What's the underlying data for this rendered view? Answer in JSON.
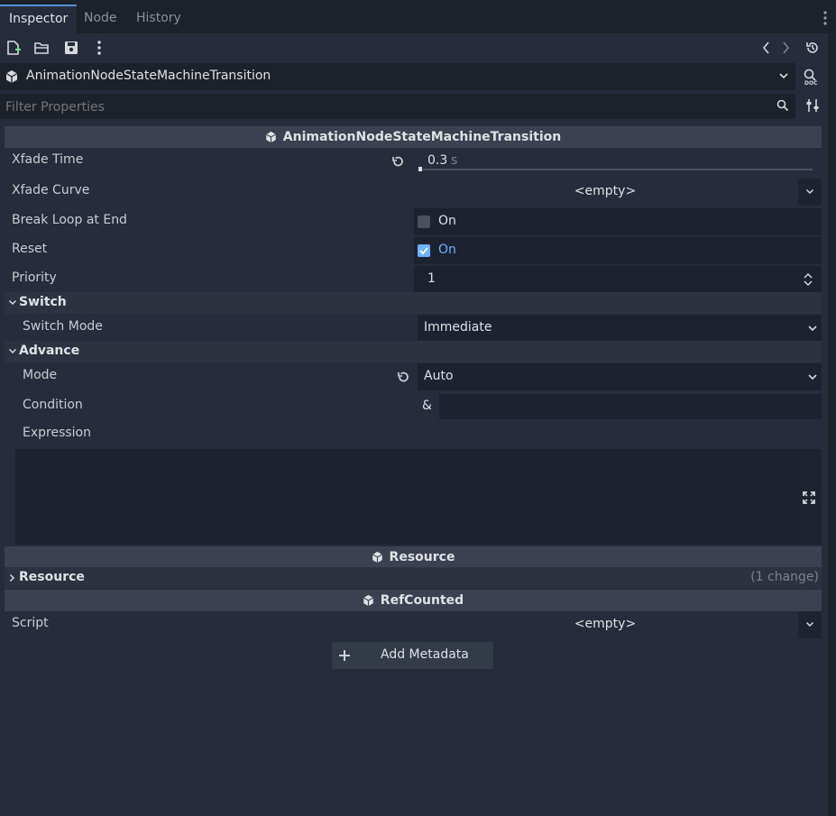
{
  "tabs": [
    {
      "label": "Inspector",
      "active": true
    },
    {
      "label": "Node",
      "active": false
    },
    {
      "label": "History",
      "active": false
    }
  ],
  "node_selector": {
    "value": "AnimationNodeStateMachineTransition"
  },
  "filter": {
    "placeholder": "Filter Properties"
  },
  "sections": {
    "main": "AnimationNodeStateMachineTransition",
    "resource": "Resource",
    "refcounted": "RefCounted"
  },
  "properties": {
    "xfade_time": {
      "label": "Xfade Time",
      "value": "0.3",
      "unit": "s"
    },
    "xfade_curve": {
      "label": "Xfade Curve",
      "value": "<empty>"
    },
    "break_loop": {
      "label": "Break Loop at End",
      "value": "On",
      "checked": false
    },
    "reset": {
      "label": "Reset",
      "value": "On",
      "checked": true
    },
    "priority": {
      "label": "Priority",
      "value": "1"
    }
  },
  "groups": {
    "switch": {
      "label": "Switch",
      "switch_mode_label": "Switch Mode",
      "switch_mode_value": "Immediate"
    },
    "advance": {
      "label": "Advance",
      "mode_label": "Mode",
      "mode_value": "Auto",
      "condition_label": "Condition",
      "condition_prefix": "&",
      "condition_value": "",
      "expression_label": "Expression",
      "expression_value": ""
    },
    "resource": {
      "label": "Resource",
      "changes": "(1 change)"
    }
  },
  "script": {
    "label": "Script",
    "value": "<empty>"
  },
  "add_metadata": {
    "label": "Add Metadata"
  },
  "colors": {
    "accent": "#4d8fdc",
    "panel": "#262c3b",
    "section": "#3b4150",
    "checked": "#6fb1ff"
  }
}
